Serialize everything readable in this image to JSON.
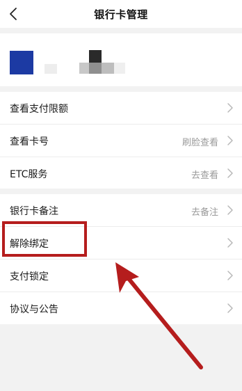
{
  "header": {
    "title": "银行卡管理",
    "back_icon": "chevron-left-icon"
  },
  "card": {
    "logo_color": "#1c3aa3"
  },
  "section1": {
    "rows": [
      {
        "label": "查看支付限额",
        "value": ""
      },
      {
        "label": "查看卡号",
        "value": "刷脸查看"
      },
      {
        "label": "ETC服务",
        "value": "去查看"
      }
    ]
  },
  "section2": {
    "rows": [
      {
        "label": "银行卡备注",
        "value": "去备注"
      },
      {
        "label": "解除绑定",
        "value": ""
      },
      {
        "label": "支付锁定",
        "value": ""
      },
      {
        "label": "协议与公告",
        "value": ""
      }
    ]
  },
  "annotation": {
    "highlight_color": "#b51d1d",
    "arrow_color": "#b51d1d"
  }
}
